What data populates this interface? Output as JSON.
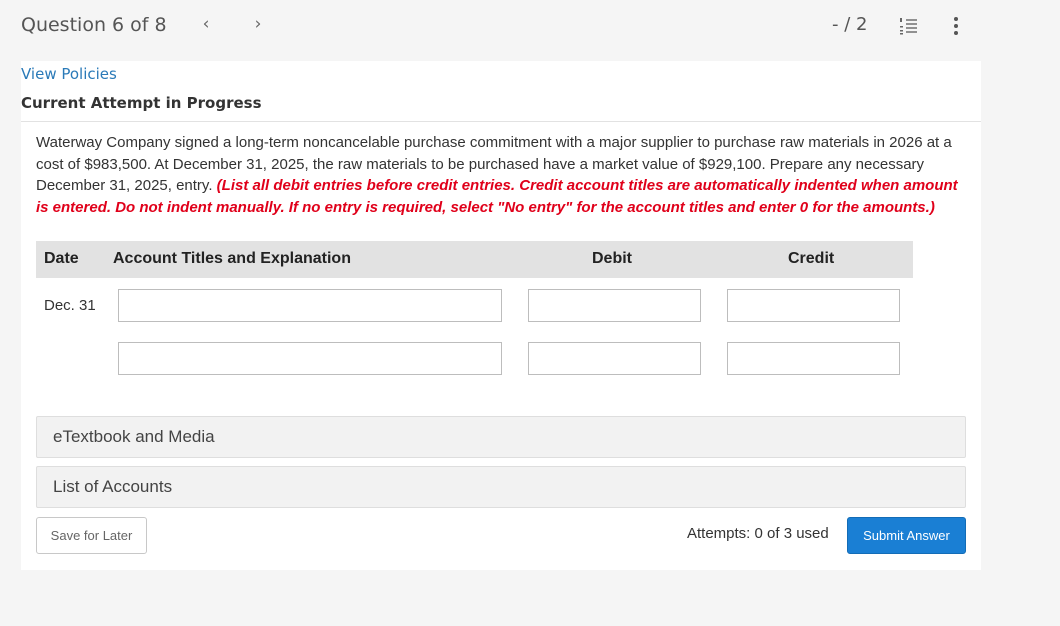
{
  "header": {
    "question_label": "Question 6 of 8",
    "prev_icon": "‹",
    "next_icon": "›",
    "score": "- / 2",
    "list_icon": "list-numbered-icon",
    "more_icon": "more-vertical-icon"
  },
  "links": {
    "view_policies": "View Policies"
  },
  "status": {
    "attempt_status": "Current Attempt in Progress"
  },
  "question": {
    "body": "Waterway Company signed a long-term noncancelable purchase commitment with a major supplier to purchase raw materials in 2026 at a cost of $983,500. At December 31, 2025, the raw materials to be purchased have a market value of $929,100. Prepare any necessary December 31, 2025, entry.",
    "instructions": "(List all debit entries before credit entries. Credit account titles are automatically indented when amount is entered. Do not indent manually. If no entry is required, select \"No entry\" for the account titles and enter 0 for the amounts.)"
  },
  "journal": {
    "headers": {
      "date": "Date",
      "account": "Account Titles and Explanation",
      "debit": "Debit",
      "credit": "Credit"
    },
    "rows": [
      {
        "date": "Dec. 31",
        "account": "",
        "debit": "",
        "credit": ""
      },
      {
        "date": "",
        "account": "",
        "debit": "",
        "credit": ""
      }
    ]
  },
  "panels": {
    "etextbook": "eTextbook and Media",
    "accounts": "List of Accounts"
  },
  "footer": {
    "save_label": "Save for Later",
    "attempts": "Attempts: 0 of 3 used",
    "submit_label": "Submit Answer"
  },
  "colors": {
    "link": "#2a7ab8",
    "instruction": "#e0001a",
    "submit": "#1a7fd4",
    "header_bg": "#e2e2e2"
  }
}
